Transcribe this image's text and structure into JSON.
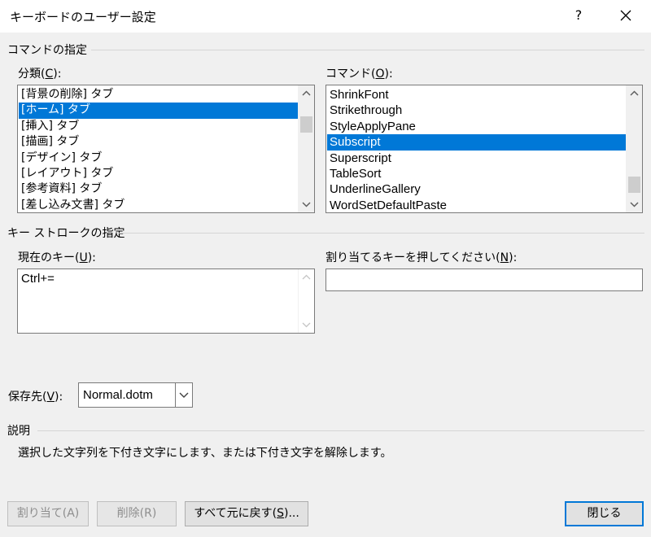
{
  "window": {
    "title": "キーボードのユーザー設定",
    "help_label": "?",
    "close_icon": "close-icon"
  },
  "commands_section": {
    "title": "コマンドの指定",
    "categories": {
      "label_prefix": "分類(",
      "label_key": "C",
      "label_suffix": "):",
      "items": [
        "[背景の削除] タブ",
        "[ホーム] タブ",
        "[挿入] タブ",
        "[描画] タブ",
        "[デザイン] タブ",
        "[レイアウト] タブ",
        "[参考資料] タブ",
        "[差し込み文書] タブ"
      ],
      "selected_index": 1
    },
    "commands": {
      "label_prefix": "コマンド(",
      "label_key": "O",
      "label_suffix": "):",
      "items": [
        "ShrinkFont",
        "Strikethrough",
        "StyleApplyPane",
        "Subscript",
        "Superscript",
        "TableSort",
        "UnderlineGallery",
        "WordSetDefaultPaste"
      ],
      "selected_index": 3
    }
  },
  "keystroke_section": {
    "title": "キー ストロークの指定",
    "current_keys": {
      "label_prefix": "現在のキー(",
      "label_key": "U",
      "label_suffix": "):",
      "values": [
        "Ctrl+="
      ]
    },
    "new_key": {
      "label_prefix": "割り当てるキーを押してください(",
      "label_key": "N",
      "label_suffix": "):",
      "value": ""
    }
  },
  "save_in": {
    "label_prefix": "保存先(",
    "label_key": "V",
    "label_suffix": "):",
    "value": "Normal.dotm"
  },
  "description": {
    "title": "説明",
    "text": "選択した文字列を下付き文字にします、または下付き文字を解除します。"
  },
  "buttons": {
    "assign": "割り当て(A)",
    "remove": "削除(R)",
    "reset_all_prefix": "すべて元に戻す(",
    "reset_all_key": "S",
    "reset_all_suffix": ")...",
    "close": "閉じる"
  },
  "colors": {
    "selection": "#0078d7",
    "background": "#f0f0f0",
    "default_button_border": "#0078d7"
  }
}
